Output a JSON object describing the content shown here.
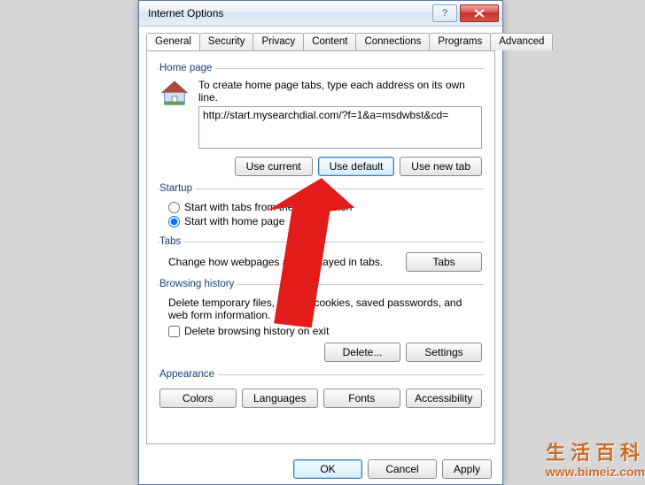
{
  "window": {
    "title": "Internet Options"
  },
  "tabs": [
    "General",
    "Security",
    "Privacy",
    "Content",
    "Connections",
    "Programs",
    "Advanced"
  ],
  "homepage": {
    "legend": "Home page",
    "instruction": "To create home page tabs, type each address on its own line.",
    "url": "http://start.mysearchdial.com/?f=1&a=msdwbst&cd=",
    "use_current": "Use current",
    "use_default": "Use default",
    "use_new_tab": "Use new tab"
  },
  "startup": {
    "legend": "Startup",
    "opt_last": "Start with tabs from the last session",
    "opt_home": "Start with home page"
  },
  "tabs_section": {
    "legend": "Tabs",
    "text": "Change how webpages are displayed in tabs.",
    "btn": "Tabs"
  },
  "history": {
    "legend": "Browsing history",
    "text": "Delete temporary files, history, cookies, saved passwords, and web form information.",
    "chk": "Delete browsing history on exit",
    "delete": "Delete...",
    "settings": "Settings"
  },
  "appearance": {
    "legend": "Appearance",
    "colors": "Colors",
    "languages": "Languages",
    "fonts": "Fonts",
    "accessibility": "Accessibility"
  },
  "dialog_buttons": {
    "ok": "OK",
    "cancel": "Cancel",
    "apply": "Apply"
  },
  "watermark": {
    "cn": "生活百科",
    "url": "www.bimeiz.com"
  }
}
